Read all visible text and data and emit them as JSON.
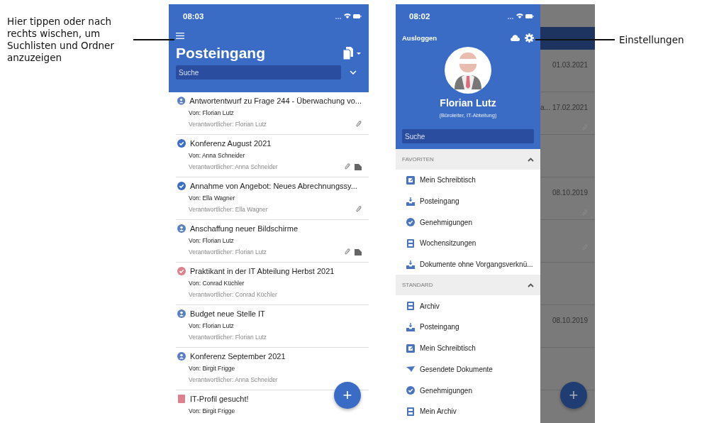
{
  "menu_annotation": "Hier tippen oder nach rechts wischen, um Suchlisten und Ordner anzuzeigen",
  "settings_annotation": "Einstellungen",
  "inbox_phone": {
    "time": "08:03",
    "title": "Posteingang",
    "search": {
      "placeholder": "Suche"
    },
    "items": [
      {
        "kind": "person",
        "color": "#5b7fc4",
        "title": "Antwortentwurf zu Frage 244 - Überwachung vo...",
        "from": "Von: Florian Lutz",
        "responsible": "Verantwortlicher: Florian Lutz",
        "attachment": true,
        "document": false
      },
      {
        "kind": "check",
        "color": "#3d6dc4",
        "title": "Konferenz August 2021",
        "from": "Von: Anna Schneider",
        "responsible": "Verantwortlicher: Anna Schneider",
        "attachment": true,
        "document": true
      },
      {
        "kind": "check",
        "color": "#3d6dc4",
        "title": "Annahme von Angebot: Neues Abrechnungssy...",
        "from": "Von: Ella Wagner",
        "responsible": "Verantwortlicher: Ella Wagner",
        "attachment": true,
        "document": false
      },
      {
        "kind": "person",
        "color": "#5b7fc4",
        "title": "Anschaffung neuer Bildschirme",
        "from": "Von: Florian Lutz",
        "responsible": "Verantwortlicher: Florian Lutz",
        "attachment": true,
        "document": true
      },
      {
        "kind": "check",
        "color": "#e0808c",
        "title": "Praktikant in der IT Abteilung Herbst 2021",
        "from": "Von: Conrad Küchler",
        "responsible": "Verantwortlicher: Conrad Küchler",
        "attachment": false,
        "document": false
      },
      {
        "kind": "person",
        "color": "#5b7fc4",
        "title": "Budget neue Stelle IT",
        "from": "Von: Florian Lutz",
        "responsible": "Verantwortlicher: Florian Lutz",
        "attachment": false,
        "document": false
      },
      {
        "kind": "person",
        "color": "#5b7fc4",
        "title": "Konferenz September 2021",
        "from": "Von: Birgit Frigge",
        "responsible": "Verantwortlicher: Anna Schneider",
        "attachment": false,
        "document": false
      },
      {
        "kind": "square",
        "color": "#e0808c",
        "title": "IT-Profil gesucht!",
        "from": "Von: Birgit Frigge",
        "attachment": false,
        "document": false
      }
    ],
    "fab": "+"
  },
  "drawer_phone": {
    "time": "08:02",
    "logout": "Ausloggen",
    "user_name": "Florian Lutz",
    "user_role": "(Büroleiter, IT-Abteilung)",
    "search": {
      "placeholder": "Suche"
    },
    "sections": [
      {
        "title": "FAVORITEN",
        "expanded": true,
        "items": [
          {
            "kind": "desk",
            "label": "Mein Schreibtisch"
          },
          {
            "kind": "inbox",
            "label": "Posteingang"
          },
          {
            "kind": "check",
            "label": "Genehmigungen"
          },
          {
            "kind": "archive",
            "label": "Wochensitzungen"
          },
          {
            "kind": "inbox",
            "label": "Dokumente ohne Vorgangsverknü..."
          }
        ]
      },
      {
        "title": "STANDARD",
        "expanded": true,
        "items": [
          {
            "kind": "archive",
            "label": "Archiv"
          },
          {
            "kind": "inbox",
            "label": "Posteingang"
          },
          {
            "kind": "desk",
            "label": "Mein Schreibtisch"
          },
          {
            "kind": "sent",
            "label": "Gesendete Dokumente"
          },
          {
            "kind": "check",
            "label": "Genehmigungen"
          },
          {
            "kind": "archive",
            "label": "Mein Archiv"
          }
        ]
      }
    ],
    "behind_rows": [
      {
        "date": "01.03.2021",
        "attachment": false
      },
      {
        "text": "a...",
        "date": "17.02.2021",
        "attachment": true
      },
      {
        "attachment": false
      },
      {
        "date": "08.10.2019",
        "attachment": true
      },
      {
        "attachment": true
      },
      {
        "attachment": false
      },
      {
        "date": "08.10.2019",
        "attachment": false
      },
      {
        "attachment": false
      }
    ],
    "fab": "+"
  }
}
